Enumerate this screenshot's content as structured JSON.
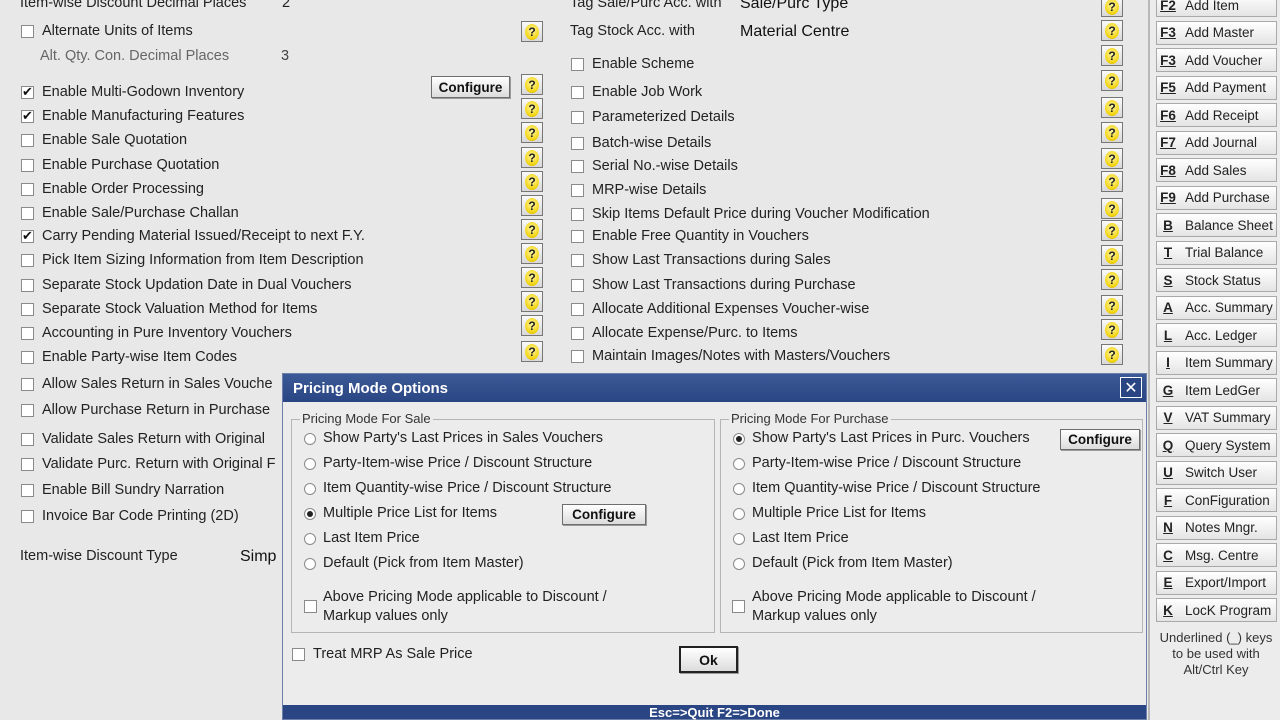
{
  "left_settings": {
    "top_partial_label": "Item-wise Discount Decimal Places",
    "top_partial_value": "2",
    "alt_units_label": "Alternate Units of Items",
    "alt_qty_label": "Alt. Qty. Con. Decimal Places",
    "alt_qty_value": "3",
    "items": [
      {
        "label": "Enable Multi-Godown Inventory",
        "checked": true
      },
      {
        "label": "Enable Manufacturing Features",
        "checked": true
      },
      {
        "label": "Enable Sale Quotation",
        "checked": false
      },
      {
        "label": "Enable Purchase Quotation",
        "checked": false
      },
      {
        "label": "Enable Order Processing",
        "checked": false
      },
      {
        "label": "Enable Sale/Purchase Challan",
        "checked": false
      },
      {
        "label": "Carry Pending Material Issued/Receipt to next F.Y.",
        "checked": true
      },
      {
        "label": "Pick Item Sizing Information from Item Description",
        "checked": false
      },
      {
        "label": "Separate Stock Updation Date in Dual Vouchers",
        "checked": false
      },
      {
        "label": "Separate Stock Valuation Method for Items",
        "checked": false
      },
      {
        "label": "Accounting in Pure Inventory Vouchers",
        "checked": false
      },
      {
        "label": "Enable Party-wise Item Codes",
        "checked": false
      }
    ],
    "lower_items": [
      {
        "label": "Allow Sales Return in Sales Vouche"
      },
      {
        "label": "Allow Purchase Return in Purchase"
      },
      {
        "label": "Validate Sales Return with Original"
      },
      {
        "label": "Validate Purc. Return with Original F"
      },
      {
        "label": "Enable Bill Sundry Narration"
      },
      {
        "label": "Invoice Bar Code Printing (2D)"
      }
    ],
    "configure_label": "Configure",
    "discount_type_label": "Item-wise Discount Type",
    "discount_type_value": "Simp"
  },
  "right_settings": {
    "tag_sale_label": "Tag Sale/Purc Acc. with",
    "tag_sale_value": "Sale/Purc Type",
    "tag_stock_label": "Tag Stock Acc. with",
    "tag_stock_value": "Material Centre",
    "items": [
      {
        "label": "Enable Scheme"
      },
      {
        "label": "Enable Job Work"
      },
      {
        "label": "Parameterized Details"
      },
      {
        "label": "Batch-wise Details"
      },
      {
        "label": "Serial No.-wise Details"
      },
      {
        "label": "MRP-wise Details"
      },
      {
        "label": "Skip Items Default Price during Voucher Modification"
      },
      {
        "label": "Enable Free Quantity in Vouchers"
      },
      {
        "label": "Show Last Transactions during Sales"
      },
      {
        "label": "Show Last Transactions during Purchase"
      },
      {
        "label": "Allocate Additional  Expenses Voucher-wise"
      },
      {
        "label": "Allocate Expense/Purc. to Items"
      },
      {
        "label": "Maintain Images/Notes with Masters/Vouchers"
      }
    ]
  },
  "shortcuts": [
    {
      "key": "F2",
      "label": "Add Item"
    },
    {
      "key": "F3",
      "label": "Add Master"
    },
    {
      "key": "F3",
      "label": "Add Voucher"
    },
    {
      "key": "F5",
      "label": "Add Payment"
    },
    {
      "key": "F6",
      "label": "Add Receipt"
    },
    {
      "key": "F7",
      "label": "Add Journal"
    },
    {
      "key": "F8",
      "label": "Add Sales"
    },
    {
      "key": "F9",
      "label": "Add Purchase"
    },
    {
      "key": "B",
      "label": "Balance Sheet"
    },
    {
      "key": "T",
      "label": "Trial Balance"
    },
    {
      "key": "S",
      "label": "Stock Status"
    },
    {
      "key": "A",
      "label": "Acc. Summary"
    },
    {
      "key": "L",
      "label": "Acc. Ledger"
    },
    {
      "key": "I",
      "label": "Item Summary"
    },
    {
      "key": "G",
      "label": "Item LedGer"
    },
    {
      "key": "V",
      "label": "VAT Summary"
    },
    {
      "key": "Q",
      "label": "Query System"
    },
    {
      "key": "U",
      "label": "Switch User"
    },
    {
      "key": "F",
      "label": "ConFiguration"
    },
    {
      "key": "N",
      "label": "Notes Mngr."
    },
    {
      "key": "C",
      "label": "Msg. Centre"
    },
    {
      "key": "E",
      "label": "Export/Import"
    },
    {
      "key": "K",
      "label": "LocK Program"
    }
  ],
  "shortcut_note": "Underlined (_) keys to be used with Alt/Ctrl Key",
  "dialog": {
    "title": "Pricing Mode Options",
    "close": "✕",
    "sale_group": {
      "title": "Pricing Mode For Sale",
      "options": [
        {
          "label": "Show Party's Last Prices in Sales Vouchers",
          "selected": false
        },
        {
          "label": "Party-Item-wise Price / Discount Structure",
          "selected": false
        },
        {
          "label": "Item Quantity-wise Price / Discount Structure",
          "selected": false
        },
        {
          "label": "Multiple Price List  for Items",
          "selected": true
        },
        {
          "label": "Last Item Price",
          "selected": false
        },
        {
          "label": "Default (Pick from Item Master)",
          "selected": false
        }
      ],
      "configure_label": "Configure",
      "above_line1": "Above Pricing Mode applicable to Discount /",
      "above_line2": "Markup values only"
    },
    "purchase_group": {
      "title": "Pricing Mode For Purchase",
      "options": [
        {
          "label": "Show Party's Last Prices in Purc. Vouchers",
          "selected": true
        },
        {
          "label": "Party-Item-wise Price / Discount Structure",
          "selected": false
        },
        {
          "label": "Item Quantity-wise Price / Discount Structure",
          "selected": false
        },
        {
          "label": "Multiple Price List for Items",
          "selected": false
        },
        {
          "label": "Last Item Price",
          "selected": false
        },
        {
          "label": "Default (Pick from Item Master)",
          "selected": false
        }
      ],
      "configure_label": "Configure",
      "above_line1": "Above Pricing Mode applicable to Discount /",
      "above_line2": "Markup values only"
    },
    "treat_mrp_label": "Treat MRP As Sale Price",
    "ok_label": "Ok",
    "footer": "Esc=>Quit   F2=>Done"
  }
}
